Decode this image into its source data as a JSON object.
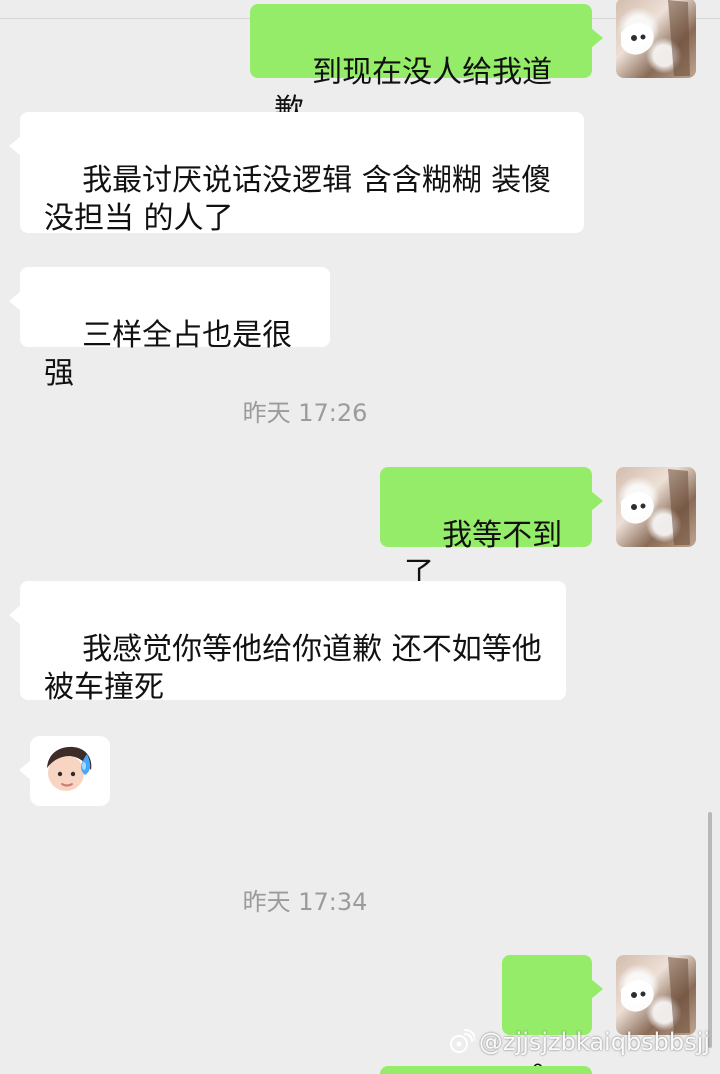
{
  "messages": [
    {
      "side": "right",
      "text": "到现在没人给我道歉"
    },
    {
      "side": "left",
      "text": "我最讨厌说话没逻辑 含含糊糊 装傻\n没担当 的人了"
    },
    {
      "side": "left",
      "text": "三样全占也是很强"
    },
    {
      "side": "timestamp",
      "text": "昨天 17:26"
    },
    {
      "side": "right",
      "text": "我等不到了"
    },
    {
      "side": "left",
      "text": "我感觉你等他给你道歉 还不如等他\n被车撞死"
    },
    {
      "side": "left",
      "type": "sticker"
    },
    {
      "side": "timestamp",
      "text": "昨天 17:34"
    },
    {
      "side": "right",
      "text": "。"
    }
  ],
  "watermark": {
    "text": "@zjjsjzbkaiqbsbbsjj"
  },
  "colors": {
    "background": "#ededed",
    "left_bubble": "#ffffff",
    "right_bubble": "#95ec69",
    "timestamp": "#9b9b9b"
  },
  "icons": {
    "avatar": "avatar-photo",
    "sticker": "girl-sweat-sticker-icon",
    "watermark": "weibo-icon"
  }
}
